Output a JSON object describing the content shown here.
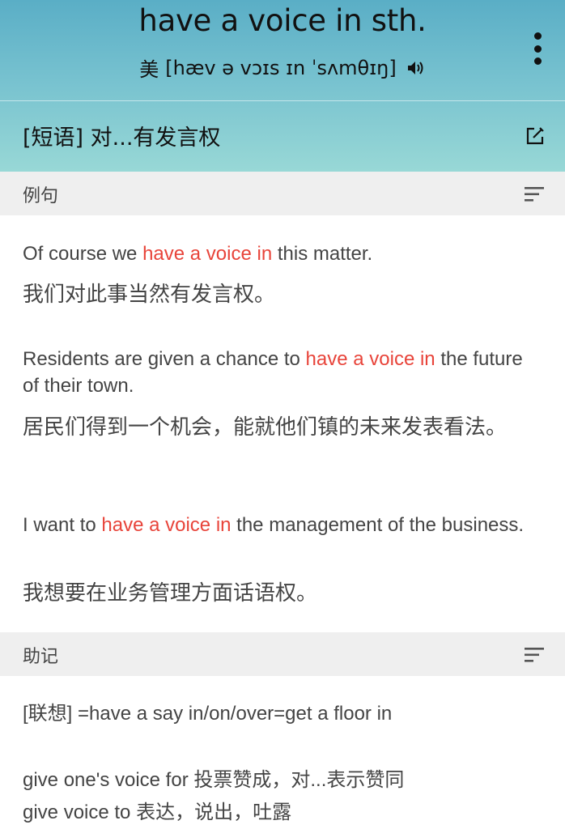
{
  "header": {
    "word": "have a voice in sth.",
    "phonetic_region": "美",
    "phonetic": "[hæv ə vɔɪs ɪn ˈsʌmθɪŋ]",
    "definition": "[短语] 对...有发言权"
  },
  "examples_section": {
    "title": "例句",
    "items": [
      {
        "en_before": "Of course we ",
        "en_highlight": "have a voice in",
        "en_after": " this matter.",
        "zh": "我们对此事当然有发言权。"
      },
      {
        "en_before": "Residents are given a chance to ",
        "en_highlight": "have a voice in",
        "en_after": " the future of their town.",
        "zh": "居民们得到一个机会，能就他们镇的未来发表看法。"
      },
      {
        "en_before": "I want to ",
        "en_highlight": "have a voice in",
        "en_after": " the management of the business.",
        "zh": "我想要在业务管理方面话语权。"
      }
    ]
  },
  "mnemonic_section": {
    "title": "助记",
    "lines": [
      "[联想] =have a say in/on/over=get a floor in",
      "give one's voice for 投票赞成，对...表示赞同",
      "give voice to 表达，说出，吐露"
    ]
  },
  "colors": {
    "highlight": "#e8443a",
    "header_top": "#5aaec6",
    "header_bottom": "#98d8d6",
    "section_bar": "#efefef"
  },
  "icons": {
    "more": "more-vertical-icon",
    "speaker": "speaker-icon",
    "edit": "edit-icon",
    "sort": "sort-lines-icon"
  }
}
